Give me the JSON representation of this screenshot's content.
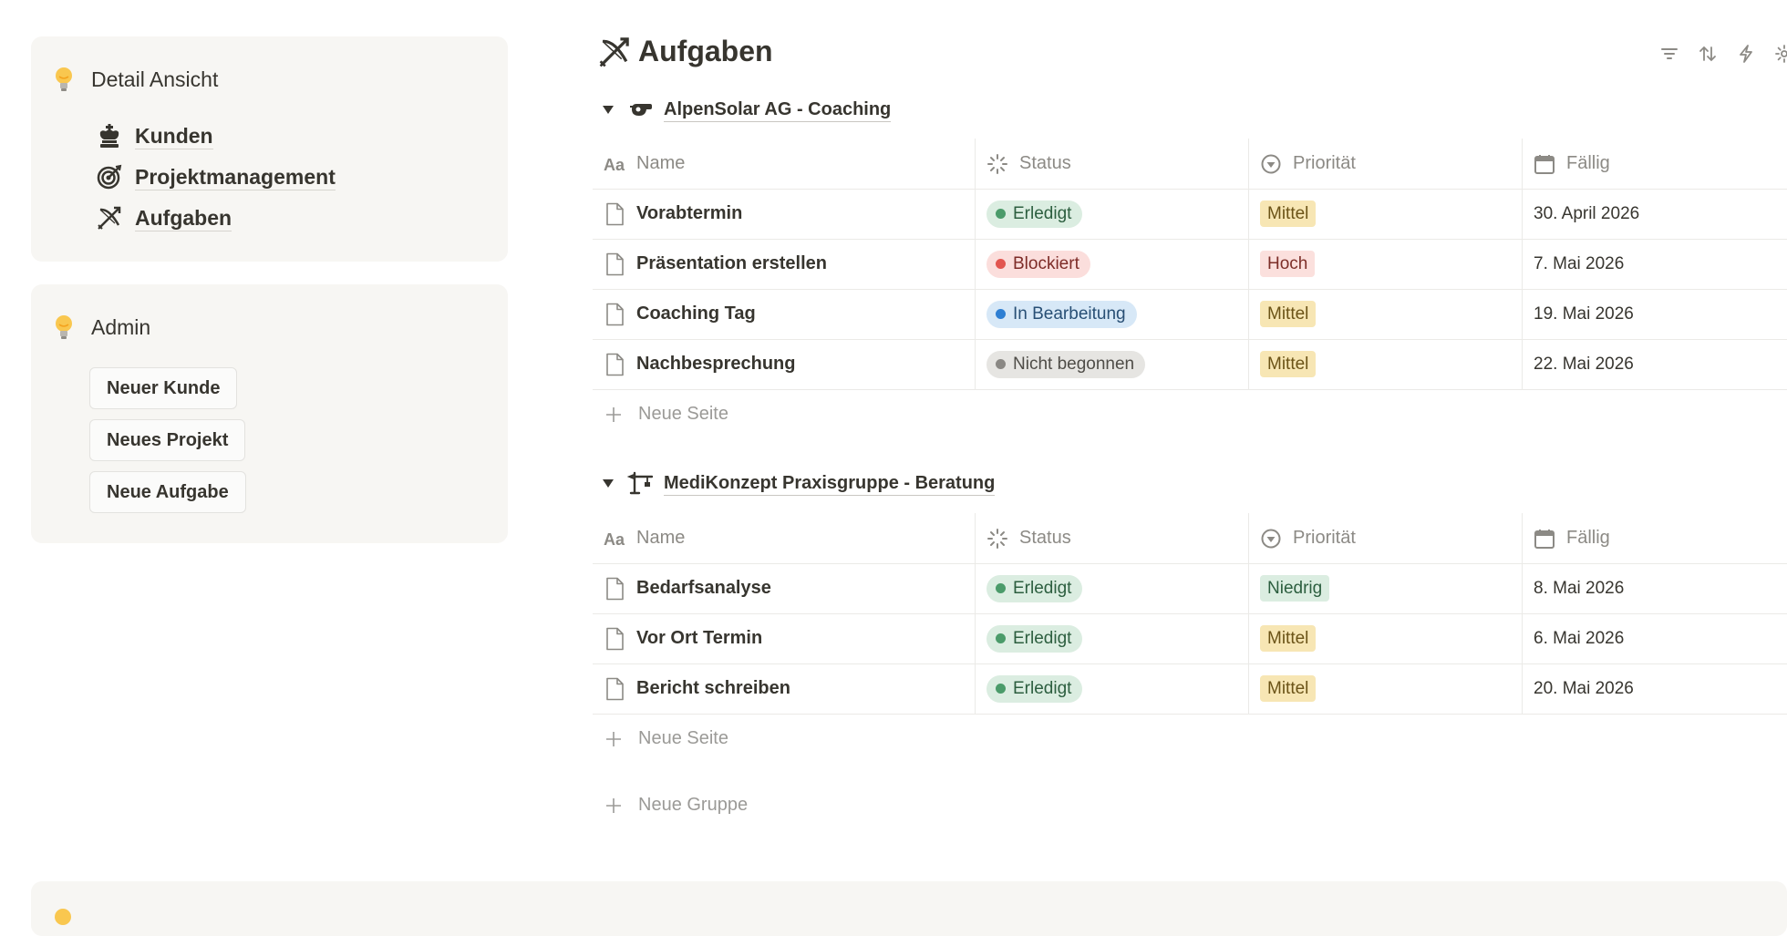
{
  "sidebar": {
    "detail": {
      "title": "Detail Ansicht",
      "links": [
        {
          "label": "Kunden",
          "icon": "chess-king-icon"
        },
        {
          "label": "Projektmanagement",
          "icon": "target-icon"
        },
        {
          "label": "Aufgaben",
          "icon": "archery-icon"
        }
      ]
    },
    "admin": {
      "title": "Admin",
      "buttons": [
        "Neuer Kunde",
        "Neues Projekt",
        "Neue Aufgabe"
      ]
    }
  },
  "page": {
    "title": "Aufgaben",
    "icon": "archery-icon"
  },
  "toolbar": [
    "filter-icon",
    "sort-icon",
    "automation-icon",
    "settings-icon"
  ],
  "columns": {
    "name": "Name",
    "status": "Status",
    "priority": "Priorität",
    "due": "Fällig"
  },
  "groups": [
    {
      "title": "AlpenSolar AG - Coaching",
      "icon": "whistle-icon",
      "rows": [
        {
          "name": "Vorabtermin",
          "status": "Erledigt",
          "priority": "Mittel",
          "due": "30. April 2026"
        },
        {
          "name": "Präsentation erstellen",
          "status": "Blockiert",
          "priority": "Hoch",
          "due": "7. Mai 2026"
        },
        {
          "name": "Coaching Tag",
          "status": "In Bearbeitung",
          "priority": "Mittel",
          "due": "19. Mai 2026"
        },
        {
          "name": "Nachbesprechung",
          "status": "Nicht begonnen",
          "priority": "Mittel",
          "due": "22. Mai 2026"
        }
      ],
      "add_label": "Neue Seite"
    },
    {
      "title": "MediKonzept Praxisgruppe - Beratung",
      "icon": "crane-icon",
      "rows": [
        {
          "name": "Bedarfsanalyse",
          "status": "Erledigt",
          "priority": "Niedrig",
          "due": "8. Mai 2026"
        },
        {
          "name": "Vor Ort Termin",
          "status": "Erledigt",
          "priority": "Mittel",
          "due": "6. Mai 2026"
        },
        {
          "name": "Bericht schreiben",
          "status": "Erledigt",
          "priority": "Mittel",
          "due": "20. Mai 2026"
        }
      ],
      "add_label": "Neue Seite"
    }
  ],
  "add_group_label": "Neue Gruppe",
  "status_colors": {
    "Erledigt": {
      "bg": "#dbede1",
      "dot": "#4b9b6a",
      "text": "#2c5e3f"
    },
    "Blockiert": {
      "bg": "#fbdedc",
      "dot": "#e2554f",
      "text": "#7d2b27"
    },
    "In Bearbeitung": {
      "bg": "#d7e8f7",
      "dot": "#2e7fd3",
      "text": "#284f75"
    },
    "Nicht begonnen": {
      "bg": "#e6e5e2",
      "dot": "#8a8884",
      "text": "#4f4d48"
    }
  },
  "priority_colors": {
    "Mittel": {
      "bg": "#f7e6b4",
      "text": "#6b5317"
    },
    "Hoch": {
      "bg": "#fbe0dd",
      "text": "#7d2f29"
    },
    "Niedrig": {
      "bg": "#dbede1",
      "text": "#2c5e3f"
    }
  }
}
